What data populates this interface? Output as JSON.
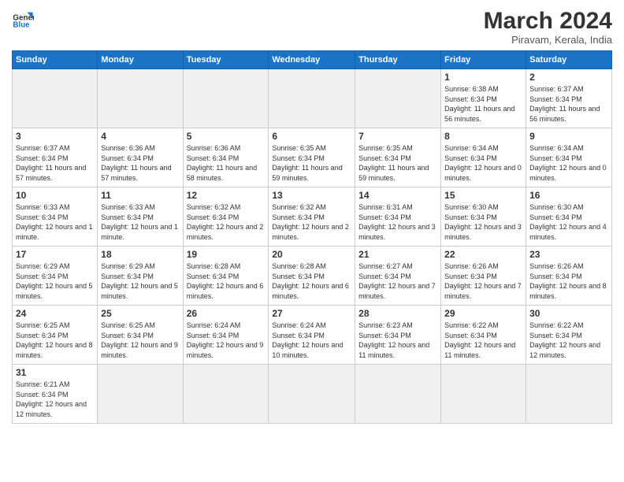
{
  "logo": {
    "text_general": "General",
    "text_blue": "Blue"
  },
  "title": "March 2024",
  "subtitle": "Piravam, Kerala, India",
  "weekdays": [
    "Sunday",
    "Monday",
    "Tuesday",
    "Wednesday",
    "Thursday",
    "Friday",
    "Saturday"
  ],
  "weeks": [
    [
      {
        "day": "",
        "empty": true
      },
      {
        "day": "",
        "empty": true
      },
      {
        "day": "",
        "empty": true
      },
      {
        "day": "",
        "empty": true
      },
      {
        "day": "",
        "empty": true
      },
      {
        "day": "1",
        "sunrise": "6:38 AM",
        "sunset": "6:34 PM",
        "daylight": "11 hours and 56 minutes."
      },
      {
        "day": "2",
        "sunrise": "6:37 AM",
        "sunset": "6:34 PM",
        "daylight": "11 hours and 56 minutes."
      }
    ],
    [
      {
        "day": "3",
        "sunrise": "6:37 AM",
        "sunset": "6:34 PM",
        "daylight": "11 hours and 57 minutes."
      },
      {
        "day": "4",
        "sunrise": "6:36 AM",
        "sunset": "6:34 PM",
        "daylight": "11 hours and 57 minutes."
      },
      {
        "day": "5",
        "sunrise": "6:36 AM",
        "sunset": "6:34 PM",
        "daylight": "11 hours and 58 minutes."
      },
      {
        "day": "6",
        "sunrise": "6:35 AM",
        "sunset": "6:34 PM",
        "daylight": "11 hours and 59 minutes."
      },
      {
        "day": "7",
        "sunrise": "6:35 AM",
        "sunset": "6:34 PM",
        "daylight": "11 hours and 59 minutes."
      },
      {
        "day": "8",
        "sunrise": "6:34 AM",
        "sunset": "6:34 PM",
        "daylight": "12 hours and 0 minutes."
      },
      {
        "day": "9",
        "sunrise": "6:34 AM",
        "sunset": "6:34 PM",
        "daylight": "12 hours and 0 minutes."
      }
    ],
    [
      {
        "day": "10",
        "sunrise": "6:33 AM",
        "sunset": "6:34 PM",
        "daylight": "12 hours and 1 minute."
      },
      {
        "day": "11",
        "sunrise": "6:33 AM",
        "sunset": "6:34 PM",
        "daylight": "12 hours and 1 minute."
      },
      {
        "day": "12",
        "sunrise": "6:32 AM",
        "sunset": "6:34 PM",
        "daylight": "12 hours and 2 minutes."
      },
      {
        "day": "13",
        "sunrise": "6:32 AM",
        "sunset": "6:34 PM",
        "daylight": "12 hours and 2 minutes."
      },
      {
        "day": "14",
        "sunrise": "6:31 AM",
        "sunset": "6:34 PM",
        "daylight": "12 hours and 3 minutes."
      },
      {
        "day": "15",
        "sunrise": "6:30 AM",
        "sunset": "6:34 PM",
        "daylight": "12 hours and 3 minutes."
      },
      {
        "day": "16",
        "sunrise": "6:30 AM",
        "sunset": "6:34 PM",
        "daylight": "12 hours and 4 minutes."
      }
    ],
    [
      {
        "day": "17",
        "sunrise": "6:29 AM",
        "sunset": "6:34 PM",
        "daylight": "12 hours and 5 minutes."
      },
      {
        "day": "18",
        "sunrise": "6:29 AM",
        "sunset": "6:34 PM",
        "daylight": "12 hours and 5 minutes."
      },
      {
        "day": "19",
        "sunrise": "6:28 AM",
        "sunset": "6:34 PM",
        "daylight": "12 hours and 6 minutes."
      },
      {
        "day": "20",
        "sunrise": "6:28 AM",
        "sunset": "6:34 PM",
        "daylight": "12 hours and 6 minutes."
      },
      {
        "day": "21",
        "sunrise": "6:27 AM",
        "sunset": "6:34 PM",
        "daylight": "12 hours and 7 minutes."
      },
      {
        "day": "22",
        "sunrise": "6:26 AM",
        "sunset": "6:34 PM",
        "daylight": "12 hours and 7 minutes."
      },
      {
        "day": "23",
        "sunrise": "6:26 AM",
        "sunset": "6:34 PM",
        "daylight": "12 hours and 8 minutes."
      }
    ],
    [
      {
        "day": "24",
        "sunrise": "6:25 AM",
        "sunset": "6:34 PM",
        "daylight": "12 hours and 8 minutes."
      },
      {
        "day": "25",
        "sunrise": "6:25 AM",
        "sunset": "6:34 PM",
        "daylight": "12 hours and 9 minutes."
      },
      {
        "day": "26",
        "sunrise": "6:24 AM",
        "sunset": "6:34 PM",
        "daylight": "12 hours and 9 minutes."
      },
      {
        "day": "27",
        "sunrise": "6:24 AM",
        "sunset": "6:34 PM",
        "daylight": "12 hours and 10 minutes."
      },
      {
        "day": "28",
        "sunrise": "6:23 AM",
        "sunset": "6:34 PM",
        "daylight": "12 hours and 11 minutes."
      },
      {
        "day": "29",
        "sunrise": "6:22 AM",
        "sunset": "6:34 PM",
        "daylight": "12 hours and 11 minutes."
      },
      {
        "day": "30",
        "sunrise": "6:22 AM",
        "sunset": "6:34 PM",
        "daylight": "12 hours and 12 minutes."
      }
    ],
    [
      {
        "day": "31",
        "sunrise": "6:21 AM",
        "sunset": "6:34 PM",
        "daylight": "12 hours and 12 minutes."
      },
      {
        "day": "",
        "empty": true
      },
      {
        "day": "",
        "empty": true
      },
      {
        "day": "",
        "empty": true
      },
      {
        "day": "",
        "empty": true
      },
      {
        "day": "",
        "empty": true
      },
      {
        "day": "",
        "empty": true
      }
    ]
  ]
}
